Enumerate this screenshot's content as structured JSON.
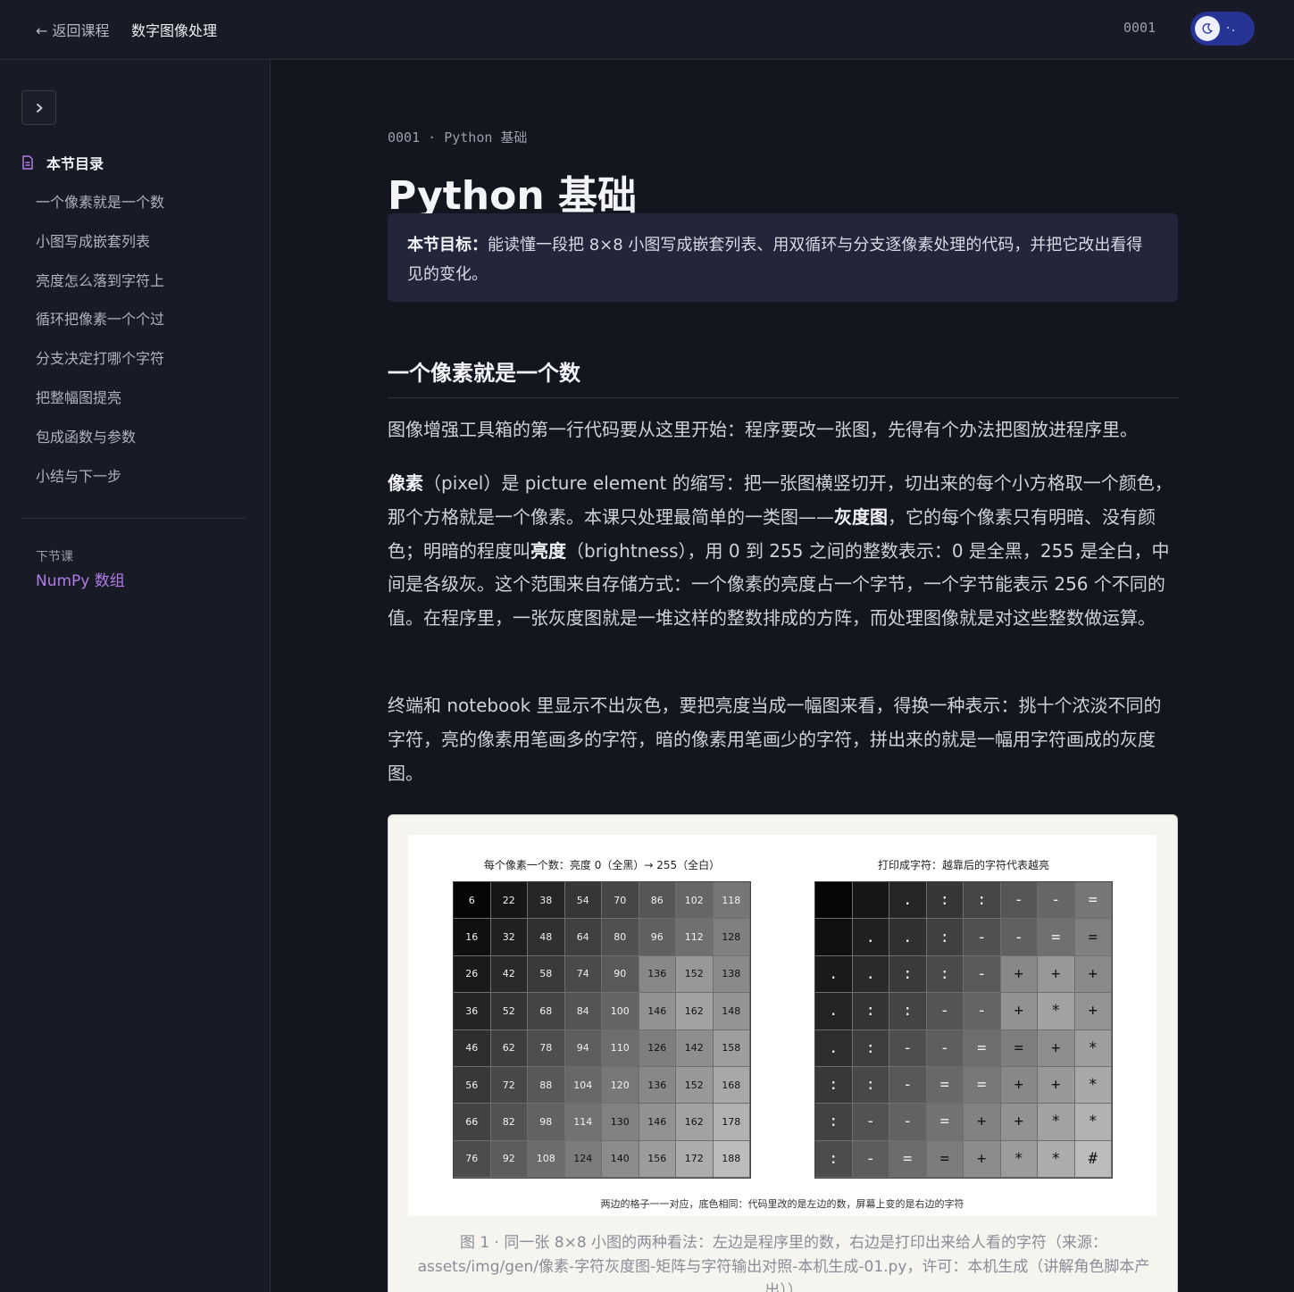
{
  "topbar": {
    "back_label": "← 返回课程",
    "course_title": "数字图像处理",
    "lesson_code": "0001",
    "theme_toggle_icon": "moon-icon"
  },
  "sidebar": {
    "toc_heading": "本节目录",
    "items": [
      "一个像素就是一个数",
      "小图写成嵌套列表",
      "亮度怎么落到字符上",
      "循环把像素一个个过",
      "分支决定打哪个字符",
      "把整幅图提亮",
      "包成函数与参数",
      "小结与下一步"
    ],
    "next_label": "下节课",
    "next_lesson": "NumPy 数组"
  },
  "main": {
    "breadcrumb": "0001 · Python 基础",
    "title": "Python 基础",
    "goal_label": "本节目标：",
    "goal_text": "能读懂一段把 8×8 小图写成嵌套列表、用双循环与分支逐像素处理的代码，并把它改出看得见的变化。",
    "section_heading": "一个像素就是一个数",
    "para1": "图像增强工具箱的第一行代码要从这里开始：程序要改一张图，先得有个办法把图放进程序里。",
    "para2": [
      {
        "t": "像素",
        "b": true
      },
      {
        "t": "（pixel）是 picture element 的缩写：把一张图横竖切开，切出来的每个小方格取一个颜色，那个方格就是一个像素。本课只处理最简单的一类图——",
        "b": false
      },
      {
        "t": "灰度图",
        "b": true
      },
      {
        "t": "，它的每个像素只有明暗、没有颜色；明暗的程度叫",
        "b": false
      },
      {
        "t": "亮度",
        "b": true
      },
      {
        "t": "（brightness），用 0 到 255 之间的整数表示：0 是全黑，255 是全白，中间是各级灰。这个范围来自存储方式：一个像素的亮度占一个字节，一个字节能表示 256 个不同的值。在程序里，一张灰度图就是一堆这样的整数排成的方阵，而处理图像就是对这些整数做运算。",
        "b": false
      }
    ],
    "para3": "终端和 notebook 里显示不出灰色，要把亮度当成一幅图来看，得换一种表示：挑十个浓淡不同的字符，亮的像素用笔画多的字符，暗的像素用笔画少的字符，拼出来的就是一幅用字符画成的灰度图。"
  },
  "figure": {
    "left_title": "每个像素一个数：亮度 0（全黑）→ 255（全白）",
    "right_title": "打印成字符：越靠后的字符代表越亮",
    "pixel_values": [
      [
        6,
        22,
        38,
        54,
        70,
        86,
        102,
        118
      ],
      [
        16,
        32,
        48,
        64,
        80,
        96,
        112,
        128
      ],
      [
        26,
        42,
        58,
        74,
        90,
        136,
        152,
        138
      ],
      [
        36,
        52,
        68,
        84,
        100,
        146,
        162,
        148
      ],
      [
        46,
        62,
        78,
        94,
        110,
        126,
        142,
        158
      ],
      [
        56,
        72,
        88,
        104,
        120,
        136,
        152,
        168
      ],
      [
        66,
        82,
        98,
        114,
        130,
        146,
        162,
        178
      ],
      [
        76,
        92,
        108,
        124,
        140,
        156,
        172,
        188
      ]
    ],
    "char_values": [
      [
        " ",
        " ",
        ".",
        ":",
        ":",
        "-",
        "-",
        "="
      ],
      [
        " ",
        ".",
        ".",
        ":",
        "-",
        "-",
        "=",
        "="
      ],
      [
        ".",
        ".",
        ":",
        ":",
        "-",
        "+",
        "+",
        "+"
      ],
      [
        ".",
        ":",
        ":",
        "-",
        "-",
        "+",
        "*",
        "+"
      ],
      [
        ".",
        ":",
        "-",
        "-",
        "=",
        "=",
        "+",
        "*"
      ],
      [
        ":",
        ":",
        "-",
        "=",
        "=",
        "+",
        "+",
        "*"
      ],
      [
        ":",
        "-",
        "-",
        "=",
        "+",
        "+",
        "*",
        "*"
      ],
      [
        ":",
        "-",
        "=",
        "=",
        "+",
        "*",
        "*",
        "#"
      ]
    ],
    "note": "两边的格子一一对应，底色相同：代码里改的是左边的数，屏幕上变的是右边的字符",
    "caption": "图 1 · 同一张 8×8 小图的两种看法：左边是程序里的数，右边是打印出来给人看的字符（来源：assets/img/gen/像素-字符灰度图-矩阵与字符输出对照-本机生成-01.py，许可：本机生成（讲解角色脚本产出））"
  }
}
